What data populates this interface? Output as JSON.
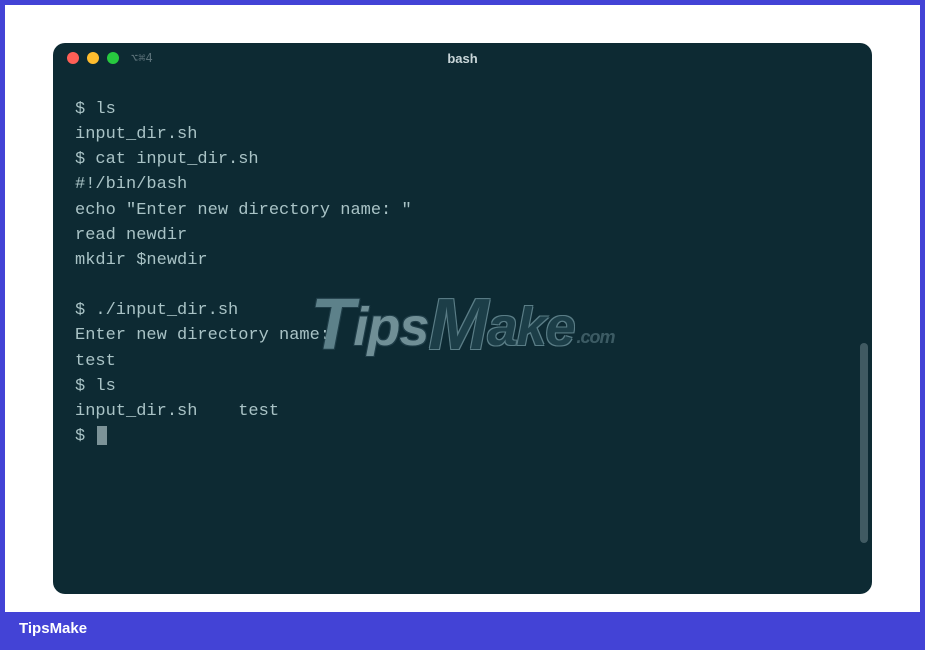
{
  "frame": {
    "footer_label": "TipsMake"
  },
  "window": {
    "title": "bash",
    "tab_indicator": "⌥⌘4",
    "traffic_lights": {
      "close": "close",
      "minimize": "minimize",
      "maximize": "maximize"
    }
  },
  "terminal": {
    "lines": [
      "$ ls",
      "input_dir.sh",
      "$ cat input_dir.sh",
      "#!/bin/bash",
      "echo \"Enter new directory name: \"",
      "read newdir",
      "mkdir $newdir",
      "",
      "$ ./input_dir.sh",
      "Enter new directory name:",
      "test",
      "$ ls",
      "input_dir.sh    test",
      "$ "
    ],
    "cursor_after_last": true
  },
  "watermark": {
    "t": "T",
    "ips": "ips",
    "m": "M",
    "ake": "ake",
    "com": ".com"
  }
}
